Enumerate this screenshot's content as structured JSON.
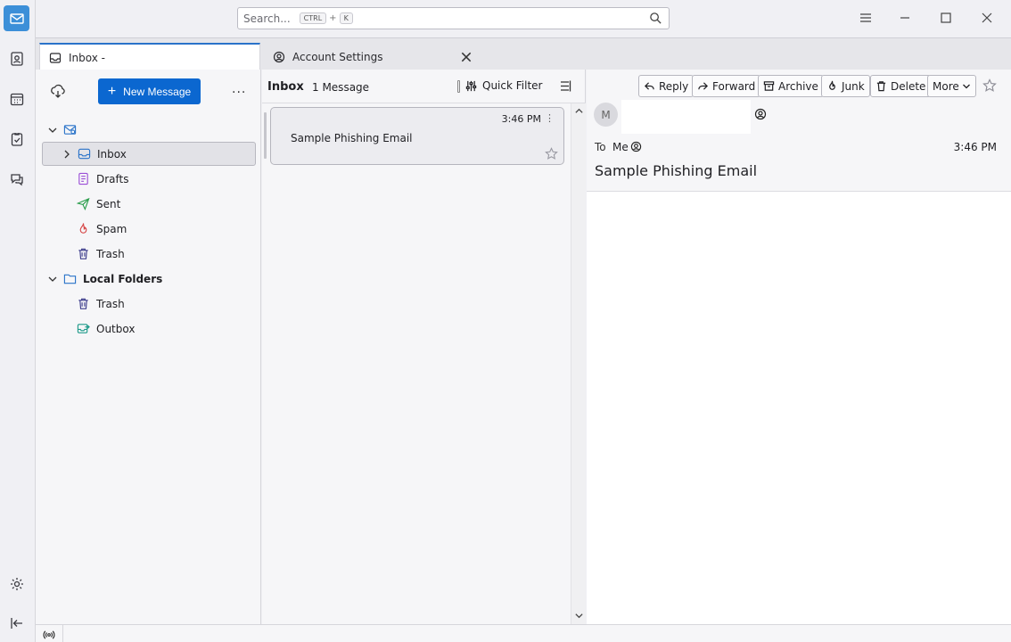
{
  "search": {
    "placeholder": "Search...",
    "shortcut_mod": "CTRL",
    "shortcut_plus": "+",
    "shortcut_key": "K"
  },
  "tabs": [
    {
      "label": "Inbox -"
    },
    {
      "label": "Account Settings"
    }
  ],
  "folder_pane": {
    "new_message": "New Message",
    "more": "...",
    "folders": [
      {
        "label": "Inbox"
      },
      {
        "label": "Drafts"
      },
      {
        "label": "Sent"
      },
      {
        "label": "Spam"
      },
      {
        "label": "Trash"
      },
      {
        "label": "Local Folders"
      },
      {
        "label": "Trash"
      },
      {
        "label": "Outbox"
      }
    ]
  },
  "thread_pane": {
    "title": "Inbox",
    "count": "1 Message",
    "quick_filter": "Quick Filter",
    "messages": [
      {
        "time": "3:46 PM",
        "subject": "Sample Phishing Email"
      }
    ]
  },
  "message_pane": {
    "buttons": {
      "reply": "Reply",
      "forward": "Forward",
      "archive": "Archive",
      "junk": "Junk",
      "delete": "Delete",
      "more": "More"
    },
    "avatar_initial": "M",
    "to_label": "To",
    "to_value": "Me",
    "time": "3:46 PM",
    "subject": "Sample Phishing Email"
  },
  "colors": {
    "accent": "#0b67d0",
    "tab_accent": "#2a73c9",
    "mail_space": "#3c8fd8"
  }
}
